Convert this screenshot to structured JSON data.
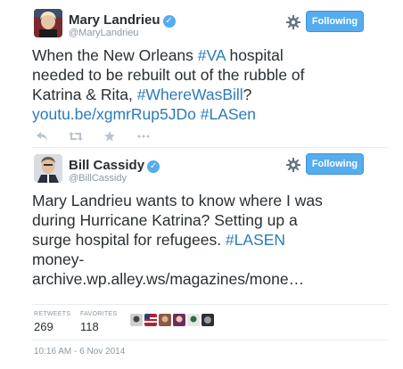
{
  "tweets": [
    {
      "name": "Mary Landrieu",
      "handle": "@MaryLandrieu",
      "follow_label": "Following",
      "lines": [
        [
          {
            "text": "When the New Orleans "
          },
          {
            "text": "#VA",
            "link": true
          },
          {
            "text": " hospital"
          }
        ],
        [
          {
            "text": "needed to be rebuilt out of the rubble of"
          }
        ],
        [
          {
            "text": "Katrina & Rita, "
          },
          {
            "text": "#WhereWasBill",
            "link": true
          },
          {
            "text": "?"
          }
        ],
        [
          {
            "text": "youtu.be/xgmrRup5JDo",
            "link": true
          },
          {
            "text": " "
          },
          {
            "text": "#LASen",
            "link": true
          }
        ]
      ]
    },
    {
      "name": "Bill Cassidy",
      "handle": "@BillCassidy",
      "follow_label": "Following",
      "lines": [
        [
          {
            "text": "Mary Landrieu wants to know where I was"
          }
        ],
        [
          {
            "text": "during Hurricane Katrina? Setting up a"
          }
        ],
        [
          {
            "text": "surge hospital for refugees. "
          },
          {
            "text": "#LASEN",
            "link": true
          }
        ],
        [
          {
            "text": "money-"
          }
        ],
        [
          {
            "text": "archive.wp.alley.ws/magazines/mone…"
          }
        ]
      ]
    }
  ],
  "stats": {
    "retweets_label": "RETWEETS",
    "retweets_count": "269",
    "favorites_label": "FAVORITES",
    "favorites_count": "118"
  },
  "timestamp": "10:16 AM - 6 Nov 2014",
  "icons": {
    "verified": "verified-badge-icon",
    "gear": "gear-icon",
    "reply": "reply-icon",
    "retweet": "retweet-icon",
    "favorite": "star-icon",
    "more": "more-icon"
  },
  "colors": {
    "link": "#2b7bb9",
    "button": "#55acee",
    "muted": "#8899a6"
  }
}
